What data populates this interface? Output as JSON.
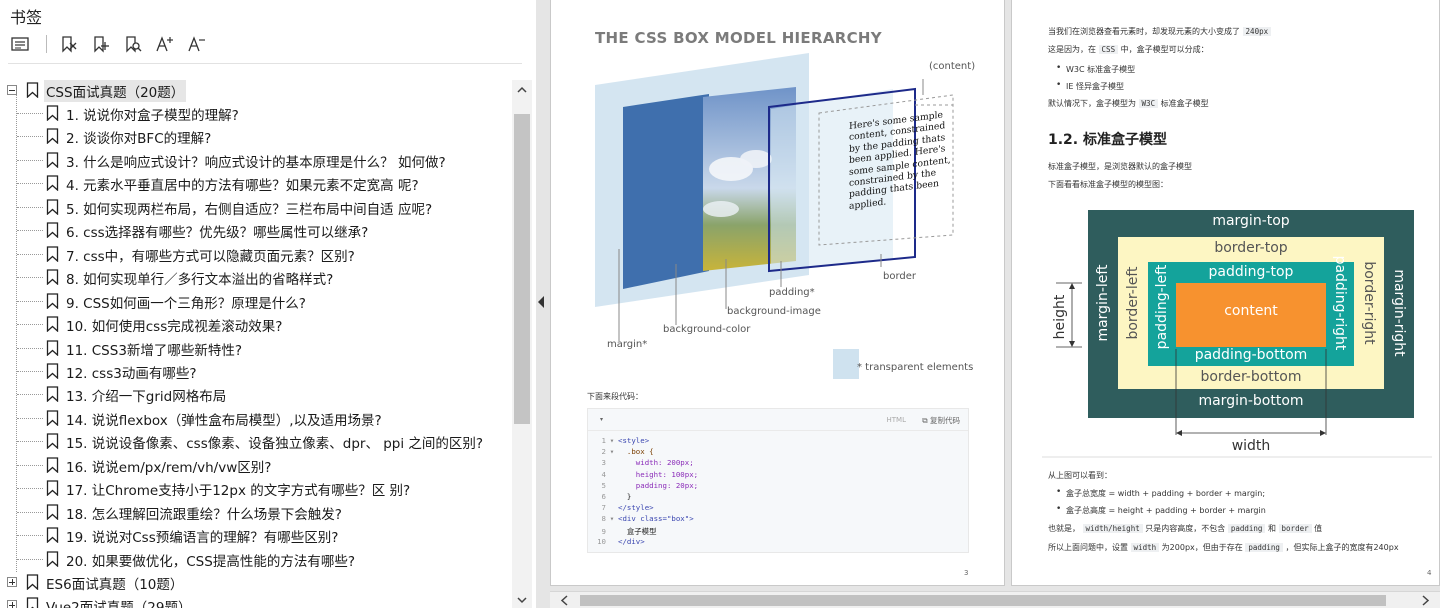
{
  "panel": {
    "title": "书签",
    "toolbar": [
      {
        "icon": "outline-list-icon"
      },
      {
        "icon": "bookmark-delete-icon"
      },
      {
        "icon": "bookmark-add-icon"
      },
      {
        "icon": "bookmark-search-icon"
      },
      {
        "icon": "font-increase-icon",
        "text": "A⁺"
      },
      {
        "icon": "font-decrease-icon",
        "text": "A⁻"
      }
    ]
  },
  "bookmarks": {
    "root1": {
      "label": "CSS面试真题（20题）",
      "expanded": true,
      "selected": true
    },
    "items": [
      "1. 说说你对盒子模型的理解?",
      "2. 谈谈你对BFC的理解?",
      "3. 什么是响应式设计？响应式设计的基本原理是什么？  如何做?",
      "4. 元素水平垂直居中的方法有哪些？如果元素不定宽高  呢?",
      "5. 如何实现两栏布局，右侧自适应？三栏布局中间自适  应呢?",
      "6. css选择器有哪些？优先级？哪些属性可以继承?",
      "7. css中，有哪些方式可以隐藏页面元素？区别?",
      "8. 如何实现单行／多行文本溢出的省略样式?",
      "9. CSS如何画一个三角形？原理是什么?",
      "10. 如何使用css完成视差滚动效果?",
      "11. CSS3新增了哪些新特性?",
      "12. css3动画有哪些?",
      "13. 介绍一下grid网格布局",
      "14. 说说flexbox（弹性盒布局模型）,以及适用场景?",
      "15. 说说设备像素、css像素、设备独立像素、dpr、  ppi 之间的区别?",
      "16. 说说em/px/rem/vh/vw区别?",
      "17. 让Chrome支持小于12px 的文字方式有哪些？区  别?",
      "18. 怎么理解回流跟重绘？什么场景下会触发?",
      "19. 说说对Css预编语言的理解？有哪些区别?",
      "20. 如果要做优化，CSS提高性能的方法有哪些?"
    ],
    "root2": {
      "label": "ES6面试真题（10题）",
      "expanded": false
    },
    "root3": {
      "label": "Vue2面试真题（29题）",
      "expanded": false
    }
  },
  "page3": {
    "page_number": "3",
    "figure_title": "THE CSS BOX MODEL HIERARCHY",
    "figure_labels": {
      "content": "(content)",
      "border": "border",
      "padding": "padding*",
      "background_image": "background-image",
      "background_color": "background-color",
      "margin": "margin*",
      "transparent": "* transparent elements"
    },
    "sample_text": [
      "Here's some sample",
      "content, constrained",
      "by the padding thats",
      "been applied. Here's",
      "some sample content,",
      "constrained by the",
      "padding thats been",
      "applied."
    ],
    "code_intro": "下面来段代码：",
    "code": {
      "lang": "HTML",
      "copy_label": "复制代码",
      "lines": [
        {
          "n": "1",
          "fold": "▾",
          "text": "<style>"
        },
        {
          "n": "2",
          "fold": "▾",
          "text": "  .box {"
        },
        {
          "n": "3",
          "fold": "",
          "text": "    width: 200px;"
        },
        {
          "n": "4",
          "fold": "",
          "text": "    height: 100px;"
        },
        {
          "n": "5",
          "fold": "",
          "text": "    padding: 20px;"
        },
        {
          "n": "6",
          "fold": "",
          "text": "  }"
        },
        {
          "n": "7",
          "fold": "",
          "text": "</style>"
        },
        {
          "n": "8",
          "fold": "▾",
          "text": "<div class=\"box\">"
        },
        {
          "n": "9",
          "fold": "",
          "text": "  盒子模型"
        },
        {
          "n": "10",
          "fold": "",
          "text": "</div>"
        }
      ]
    }
  },
  "page4": {
    "page_number": "4",
    "intro_1_a": "当我们在浏览器查看元素时，却发现元素的大小变成了",
    "intro_1_code": "240px",
    "intro_2_a": "这是因为，在",
    "intro_2_code": "CSS",
    "intro_2_b": "中，盒子模型可以分成：",
    "bullets_1": [
      "W3C 标准盒子模型",
      "IE 怪异盒子模型"
    ],
    "default_a": "默认情况下，盒子模型为",
    "default_code": "W3C",
    "default_b": "标准盒子模型",
    "heading": "1.2. 标准盒子模型",
    "desc_1": "标准盒子模型，是浏览器默认的盒子模型",
    "desc_2": "下面看看标准盒子模型的模型图：",
    "diagram": {
      "margin_top": "margin-top",
      "border_top": "border-top",
      "padding_top": "padding-top",
      "content": "content",
      "padding_bottom": "padding-bottom",
      "border_bottom": "border-bottom",
      "margin_bottom": "margin-bottom",
      "margin_left": "margin-left",
      "border_left": "border-left",
      "padding_left": "padding-left",
      "padding_right": "padding-right",
      "border_right": "border-right",
      "margin_right": "margin-right",
      "height": "height",
      "width": "width"
    },
    "see_text": "从上图可以看到：",
    "bullets_2": [
      "盒子总宽度 = width + padding + border + margin;",
      "盒子总高度 = height + padding + border + margin"
    ],
    "also_a": "也就是，",
    "also_code1": "width/height",
    "also_b": "只是内容高度，不包含",
    "also_code2": "padding",
    "also_c": "和",
    "also_code3": "border",
    "also_d": "值",
    "last_a": "所以上面问题中，设置",
    "last_code1": "width",
    "last_b": "为200px，但由于存在",
    "last_code2": "padding",
    "last_c": "，但实际上盒子的宽度有240px"
  },
  "colors": {
    "margin": "#2f5d5d",
    "border": "#fdf6c3",
    "padding": "#14a39b",
    "content": "#f7922f",
    "selected": "#e6e6e6"
  }
}
